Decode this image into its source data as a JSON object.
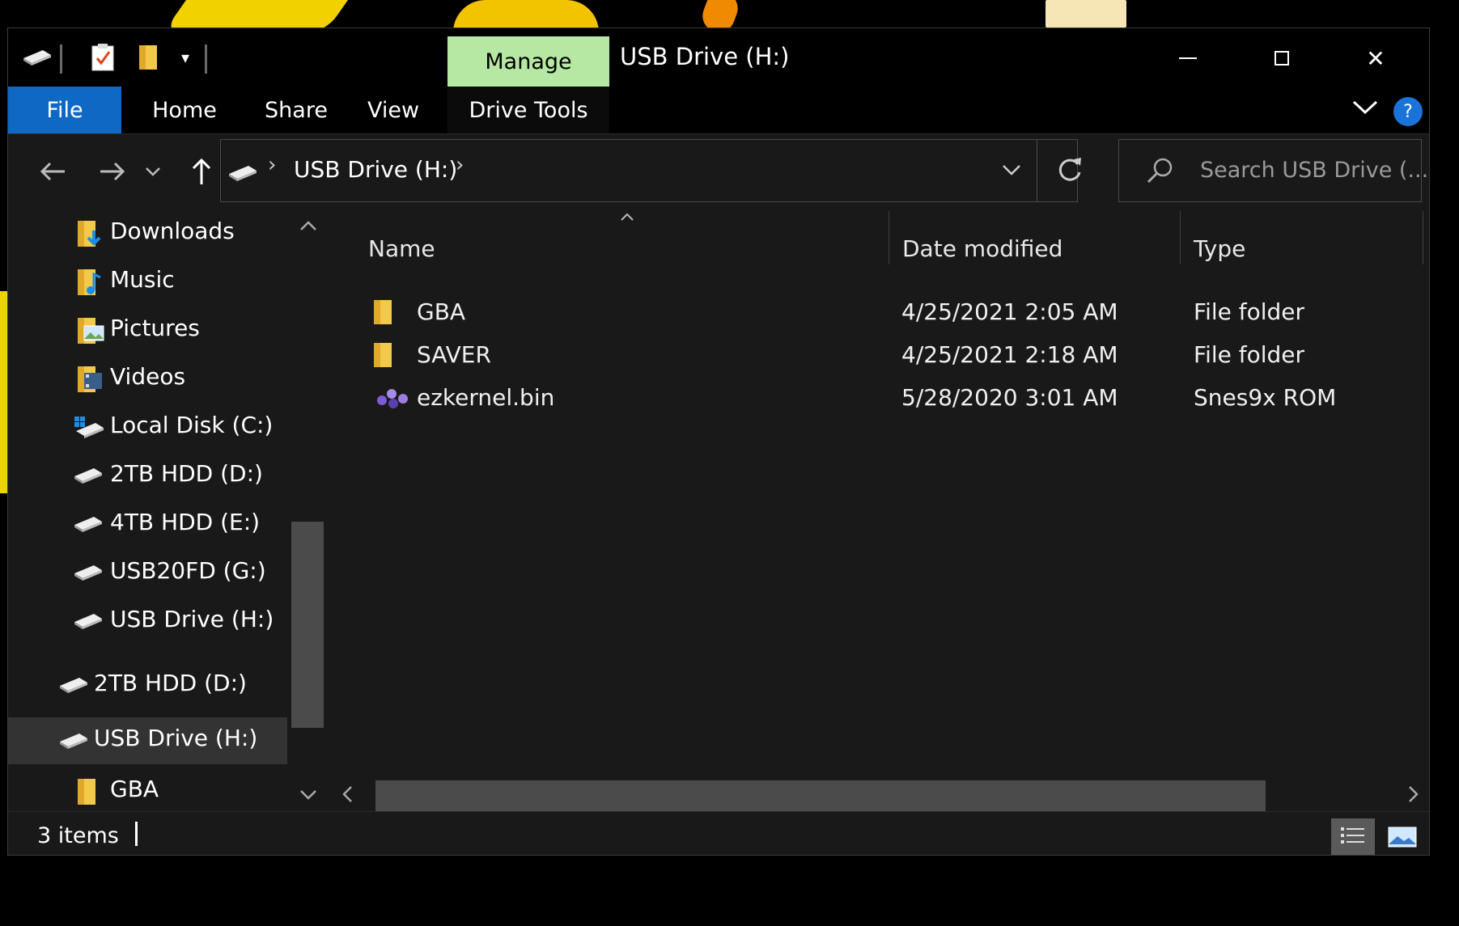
{
  "window": {
    "title": "USB Drive (H:)",
    "manage_label": "Manage",
    "minimize_glyph": "—",
    "maximize_glyph": "☐",
    "close_glyph": "✕"
  },
  "ribbon": {
    "tabs": [
      {
        "label": "File"
      },
      {
        "label": "Home"
      },
      {
        "label": "Share"
      },
      {
        "label": "View"
      },
      {
        "label": "Drive Tools"
      }
    ],
    "help_glyph": "?",
    "expand_glyph": "⌄"
  },
  "address": {
    "path": "USB Drive (H:)",
    "search_placeholder": "Search USB Drive (..."
  },
  "nav": {
    "items": [
      {
        "label": "Downloads",
        "icon": "downloads-folder-icon"
      },
      {
        "label": "Music",
        "icon": "music-folder-icon"
      },
      {
        "label": "Pictures",
        "icon": "pictures-folder-icon"
      },
      {
        "label": "Videos",
        "icon": "videos-folder-icon"
      },
      {
        "label": "Local Disk (C:)",
        "icon": "windows-drive-icon"
      },
      {
        "label": "2TB HDD (D:)",
        "icon": "drive-icon"
      },
      {
        "label": "4TB HDD (E:)",
        "icon": "drive-icon"
      },
      {
        "label": "USB20FD (G:)",
        "icon": "drive-icon"
      },
      {
        "label": "USB Drive (H:)",
        "icon": "drive-icon"
      },
      {
        "label": "2TB HDD (D:)",
        "icon": "drive-icon"
      },
      {
        "label": "USB Drive (H:)",
        "icon": "drive-icon",
        "selected": true
      },
      {
        "label": "GBA",
        "icon": "folder-icon"
      }
    ]
  },
  "files": {
    "columns": {
      "name": "Name",
      "date": "Date modified",
      "type": "Type"
    },
    "rows": [
      {
        "name": "GBA",
        "date": "4/25/2021 2:05 AM",
        "type": "File folder",
        "icon": "folder-icon"
      },
      {
        "name": "SAVER",
        "date": "4/25/2021 2:18 AM",
        "type": "File folder",
        "icon": "folder-icon"
      },
      {
        "name": "ezkernel.bin",
        "date": "5/28/2020 3:01 AM",
        "type": "Snes9x ROM",
        "icon": "snes-rom-icon"
      }
    ]
  },
  "status": {
    "items_count": "3 items"
  },
  "colors": {
    "accent": "#0f68c3",
    "manage_tab": "#b6e8a3",
    "window_bg": "#191919",
    "folder_yellow": "#f3c94a"
  }
}
